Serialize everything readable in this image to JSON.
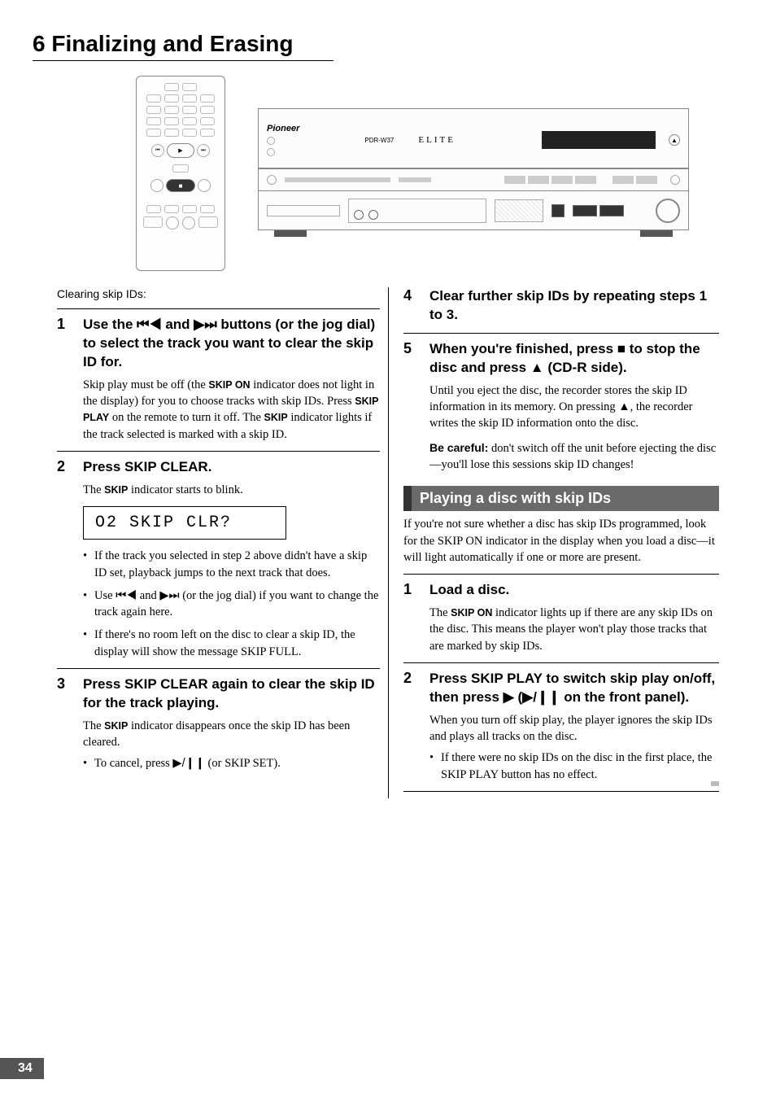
{
  "chapter": {
    "number": "6",
    "title": "Finalizing and Erasing"
  },
  "unit": {
    "brand": "Pioneer",
    "model": "PDR-W37",
    "elite": "ELITE"
  },
  "left": {
    "intro": "Clearing skip IDs:",
    "step1": {
      "num": "1",
      "head_a": "Use the ",
      "head_b": " and ",
      "head_c": " buttons (or the jog dial) to select  the track you want to clear the skip ID for.",
      "body_a": "Skip play must be off (the ",
      "body_b": " indicator does not light in the display) for you to choose tracks with skip IDs. Press ",
      "body_c": " on the remote to turn it off.  The ",
      "body_d": " indicator lights if the track selected is marked with a skip ID.",
      "kw_skip_on": "SKIP ON",
      "kw_skip_play": "SKIP PLAY",
      "kw_skip": "SKIP"
    },
    "step2": {
      "num": "2",
      "head": "Press SKIP CLEAR.",
      "body_a": "The ",
      "body_b": " indicator starts to blink.",
      "kw_skip": "SKIP",
      "lcd": "O2  SKIP  CLR?",
      "bullet1": "If the track you selected in step 2 above didn't have a skip ID set, playback jumps to the next track that does.",
      "bullet2_a": "Use ",
      "bullet2_b": " and ",
      "bullet2_c": " (or the jog dial) if you want to change the track again here.",
      "bullet3_a": "If there's no room left on the disc to clear a skip ID, the display will show the message ",
      "bullet3_b": ".",
      "kw_skip_full": "SKIP FULL"
    },
    "step3": {
      "num": "3",
      "head": "Press SKIP CLEAR again to clear the skip ID for the track playing.",
      "body_a": "The ",
      "body_b": " indicator disappears once the skip ID has been cleared.",
      "kw_skip": "SKIP",
      "bullet_a": "To cancel, press ",
      "bullet_b": " (or ",
      "bullet_c": ").",
      "kw_skip_set": "SKIP SET"
    }
  },
  "right": {
    "step4": {
      "num": "4",
      "head": "Clear further skip IDs by repeating steps 1 to 3."
    },
    "step5": {
      "num": "5",
      "head_a": "When you're finished, press ",
      "head_b": " to stop the disc and press ",
      "head_c": " (CD-R side).",
      "body_a": "Until you eject the disc, the recorder stores the skip ID information in its memory. On pressing ",
      "body_b": ", the recorder writes the skip ID information onto the disc.",
      "careful_label": "Be careful:",
      "careful_text": " don't switch off the unit before ejecting the disc—you'll lose this sessions skip ID changes!"
    },
    "section_title": "Playing a disc with skip IDs",
    "section_intro_a": "If you're not sure whether a disc has skip IDs programmed, look for the ",
    "section_intro_b": " indicator in the display when you load a disc—it will light automatically if one or more are present.",
    "kw_skip_on": "SKIP ON",
    "pstep1": {
      "num": "1",
      "head": "Load a disc.",
      "body_a": "The ",
      "body_b": " indicator lights up if there are any skip IDs on the disc. This means the player won't play those tracks that are marked by skip IDs.",
      "kw_skip_on": "SKIP ON"
    },
    "pstep2": {
      "num": "2",
      "head_a": "Press SKIP PLAY to switch skip play on/off, then press ",
      "head_b": " (",
      "head_c": " on the front panel).",
      "body": "When you turn off skip play, the player ignores the skip IDs and plays all tracks on the disc.",
      "bullet_a": "If there were no skip IDs on the disc in the first place, the ",
      "bullet_b": " button has no effect.",
      "kw_skip_play": "SKIP PLAY"
    }
  },
  "glyphs": {
    "prev": "⏮◀",
    "next": "▶⏭",
    "stop": "■",
    "eject": "▲",
    "play": "▶",
    "playpause": "▶/❙❙"
  },
  "page_number": "34"
}
